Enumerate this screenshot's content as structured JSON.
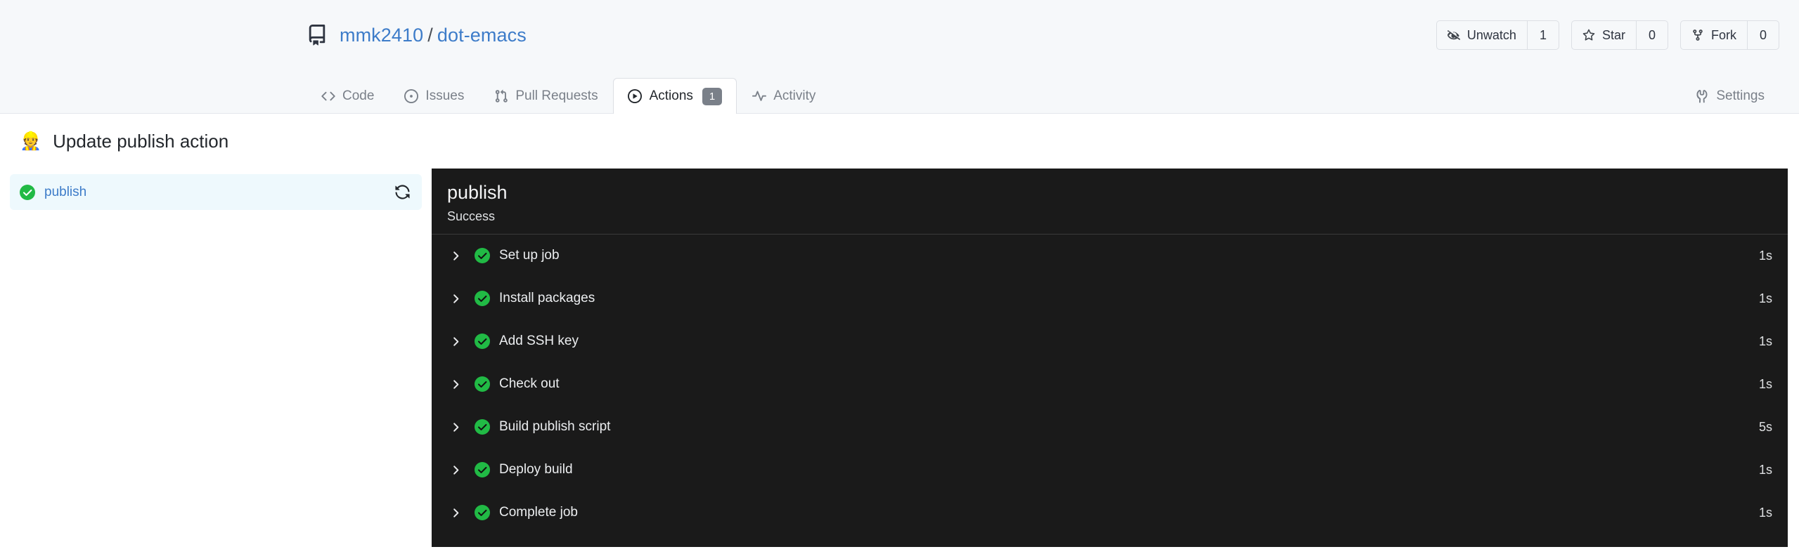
{
  "repo": {
    "icon": "repo-book-icon",
    "owner": "mmk2410",
    "separator": "/",
    "name": "dot-emacs"
  },
  "repo_actions": [
    {
      "icon": "eye-slash-icon",
      "label": "Unwatch",
      "count": "1"
    },
    {
      "icon": "star-icon",
      "label": "Star",
      "count": "0"
    },
    {
      "icon": "fork-icon",
      "label": "Fork",
      "count": "0"
    }
  ],
  "nav": {
    "tabs": [
      {
        "icon": "code-icon",
        "label": "Code",
        "active": false,
        "badge": null
      },
      {
        "icon": "issue-opened-icon",
        "label": "Issues",
        "active": false,
        "badge": null
      },
      {
        "icon": "git-pull-request-icon",
        "label": "Pull Requests",
        "active": false,
        "badge": null
      },
      {
        "icon": "play-circle-icon",
        "label": "Actions",
        "active": true,
        "badge": "1"
      },
      {
        "icon": "pulse-icon",
        "label": "Activity",
        "active": false,
        "badge": null
      }
    ],
    "settings": {
      "icon": "wrench-icon",
      "label": "Settings"
    }
  },
  "run": {
    "emoji": "👷",
    "title": "Update publish action"
  },
  "jobs": [
    {
      "status_icon": "check-circle-icon",
      "name": "publish",
      "selected": true,
      "rerun_icon": "rerun-sync-icon"
    }
  ],
  "log": {
    "title": "publish",
    "status": "Success",
    "steps": [
      {
        "chevron": "chevron-right-icon",
        "status_icon": "check-circle-icon",
        "name": "Set up job",
        "duration": "1s"
      },
      {
        "chevron": "chevron-right-icon",
        "status_icon": "check-circle-icon",
        "name": "Install packages",
        "duration": "1s"
      },
      {
        "chevron": "chevron-right-icon",
        "status_icon": "check-circle-icon",
        "name": "Add SSH key",
        "duration": "1s"
      },
      {
        "chevron": "chevron-right-icon",
        "status_icon": "check-circle-icon",
        "name": "Check out",
        "duration": "1s"
      },
      {
        "chevron": "chevron-right-icon",
        "status_icon": "check-circle-icon",
        "name": "Build publish script",
        "duration": "5s"
      },
      {
        "chevron": "chevron-right-icon",
        "status_icon": "check-circle-icon",
        "name": "Deploy build",
        "duration": "1s"
      },
      {
        "chevron": "chevron-right-icon",
        "status_icon": "check-circle-icon",
        "name": "Complete job",
        "duration": "1s"
      }
    ]
  },
  "colors": {
    "header_bg": "#f6f8fa",
    "link": "#3d7cc9",
    "success_green": "#21ba45",
    "log_bg": "#1a1a1a",
    "selected_job_bg": "#eef9fd"
  }
}
